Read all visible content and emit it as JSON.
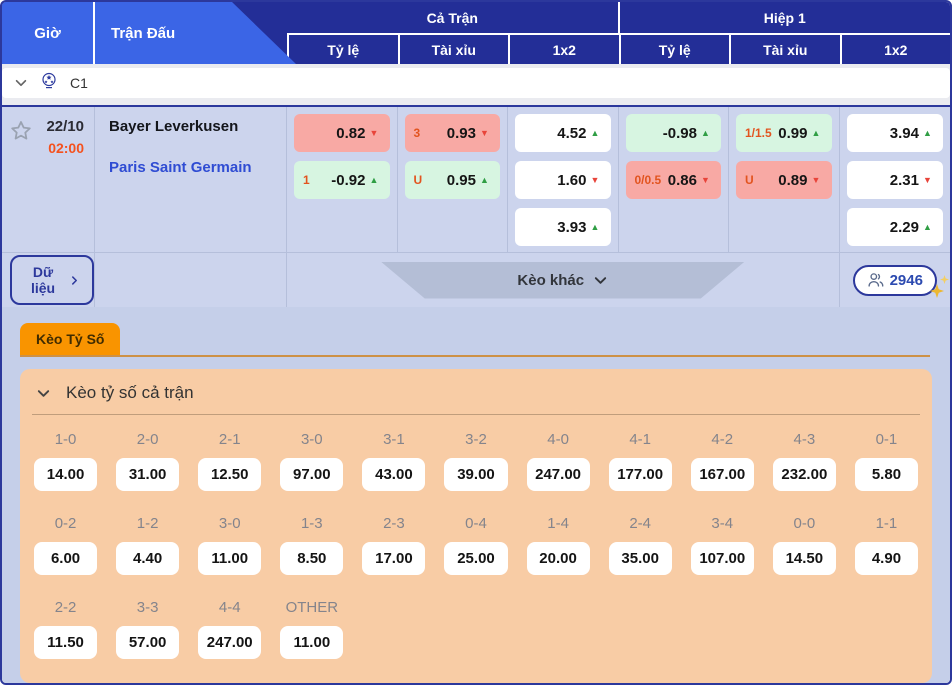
{
  "header": {
    "tabs": [
      {
        "label": "Giờ"
      },
      {
        "label": "Trận Đấu"
      }
    ],
    "groups": [
      {
        "label": "Cả Trận"
      },
      {
        "label": "Hiệp 1"
      }
    ],
    "sub_columns": [
      {
        "label": "Tỷ lệ"
      },
      {
        "label": "Tài xỉu"
      },
      {
        "label": "1x2"
      },
      {
        "label": "Tỷ lệ"
      },
      {
        "label": "Tài xỉu"
      },
      {
        "label": "1x2"
      }
    ]
  },
  "league": {
    "name": "C1"
  },
  "match": {
    "date": "22/10",
    "time": "02:00",
    "home": "Bayer Leverkusen",
    "away": "Paris Saint Germain",
    "full_handicap": [
      {
        "label": "",
        "value": "0.82",
        "arrow": "▼",
        "dir": "down",
        "tone": "pink"
      },
      {
        "label": "1",
        "value": "-0.92",
        "arrow": "▲",
        "dir": "up",
        "tone": "green"
      }
    ],
    "full_ou": [
      {
        "label": "3",
        "value": "0.93",
        "arrow": "▼",
        "dir": "down",
        "tone": "pink"
      },
      {
        "label": "U",
        "value": "0.95",
        "arrow": "▲",
        "dir": "up",
        "tone": "green"
      }
    ],
    "full_1x2": [
      {
        "value": "4.52",
        "arrow": "▲",
        "dir": "up",
        "tone": "white"
      },
      {
        "value": "1.60",
        "arrow": "▼",
        "dir": "down",
        "tone": "white"
      },
      {
        "value": "3.93",
        "arrow": "▲",
        "dir": "up",
        "tone": "white"
      }
    ],
    "half_handicap": [
      {
        "label": "",
        "value": "-0.98",
        "arrow": "▲",
        "dir": "up",
        "tone": "green"
      },
      {
        "label": "0/0.5",
        "value": "0.86",
        "arrow": "▼",
        "dir": "down",
        "tone": "pink"
      }
    ],
    "half_ou": [
      {
        "label": "1/1.5",
        "value": "0.99",
        "arrow": "▲",
        "dir": "up",
        "tone": "green"
      },
      {
        "label": "U",
        "value": "0.89",
        "arrow": "▼",
        "dir": "down",
        "tone": "pink"
      }
    ],
    "half_1x2": [
      {
        "value": "3.94",
        "arrow": "▲",
        "dir": "up",
        "tone": "white"
      },
      {
        "value": "2.31",
        "arrow": "▼",
        "dir": "down",
        "tone": "white"
      },
      {
        "value": "2.29",
        "arrow": "▲",
        "dir": "up",
        "tone": "white"
      }
    ],
    "data_button": "Dữ liệu",
    "more_odds_button": "Kèo khác",
    "viewers_count": "2946"
  },
  "score_panel": {
    "tab": "Kèo Tỷ Số",
    "title": "Kèo tỷ số cả trận",
    "rows": [
      [
        {
          "score": "1-0",
          "odds": "14.00"
        },
        {
          "score": "2-0",
          "odds": "31.00"
        },
        {
          "score": "2-1",
          "odds": "12.50"
        },
        {
          "score": "3-0",
          "odds": "97.00"
        },
        {
          "score": "3-1",
          "odds": "43.00"
        },
        {
          "score": "3-2",
          "odds": "39.00"
        },
        {
          "score": "4-0",
          "odds": "247.00"
        },
        {
          "score": "4-1",
          "odds": "177.00"
        },
        {
          "score": "4-2",
          "odds": "167.00"
        },
        {
          "score": "4-3",
          "odds": "232.00"
        },
        {
          "score": "0-1",
          "odds": "5.80"
        }
      ],
      [
        {
          "score": "0-2",
          "odds": "6.00"
        },
        {
          "score": "1-2",
          "odds": "4.40"
        },
        {
          "score": "3-0",
          "odds": "11.00"
        },
        {
          "score": "1-3",
          "odds": "8.50"
        },
        {
          "score": "2-3",
          "odds": "17.00"
        },
        {
          "score": "0-4",
          "odds": "25.00"
        },
        {
          "score": "1-4",
          "odds": "20.00"
        },
        {
          "score": "2-4",
          "odds": "35.00"
        },
        {
          "score": "3-4",
          "odds": "107.00"
        },
        {
          "score": "0-0",
          "odds": "14.50"
        },
        {
          "score": "1-1",
          "odds": "4.90"
        }
      ],
      [
        {
          "score": "2-2",
          "odds": "11.50"
        },
        {
          "score": "3-3",
          "odds": "57.00"
        },
        {
          "score": "4-4",
          "odds": "247.00"
        },
        {
          "score": "OTHER",
          "odds": "11.00"
        }
      ]
    ]
  },
  "icons": {
    "favorite": "star-outline",
    "league": "starball",
    "collapse": "chevron-down",
    "trend_up": "▲",
    "trend_down": "▼",
    "data_more": "chevron-right",
    "more_odds": "chevron-down",
    "viewers": "people",
    "sparkle": "four-point-star"
  },
  "colors": {
    "navy": "#232e97",
    "accent_blue": "#3b65e6",
    "lavender": "#ccd4ed",
    "pink": "#f8a9a4",
    "green": "#d7f5e1",
    "up": "#2f9e44",
    "down": "#e8443a",
    "label_orange": "#e2541f",
    "time_orange": "#f4511e",
    "away_blue": "#2f4cd3",
    "tab_orange": "#f99400",
    "peach": "#f8cca5"
  }
}
